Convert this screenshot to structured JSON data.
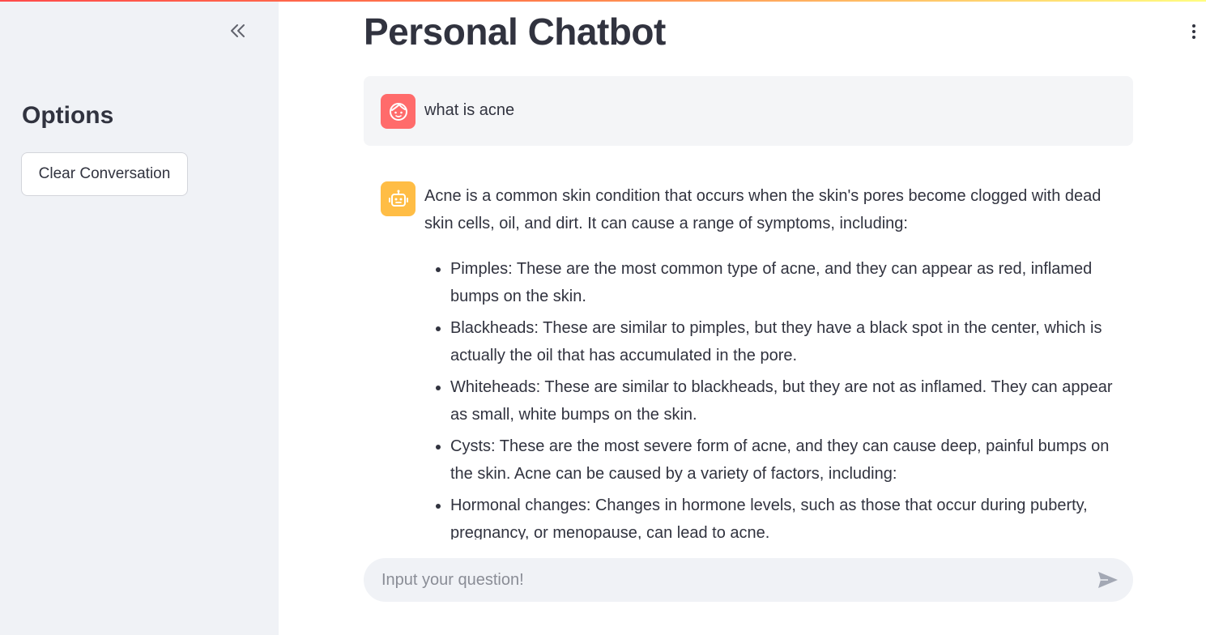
{
  "sidebar": {
    "heading": "Options",
    "clear_button_label": "Clear Conversation"
  },
  "main": {
    "title": "Personal Chatbot"
  },
  "messages": {
    "user": {
      "avatar_icon": "user-face-icon",
      "text": "what is acne"
    },
    "assistant": {
      "avatar_icon": "robot-icon",
      "intro": "Acne is a common skin condition that occurs when the skin's pores become clogged with dead skin cells, oil, and dirt. It can cause a range of symptoms, including:",
      "items": [
        "Pimples: These are the most common type of acne, and they can appear as red, inflamed bumps on the skin.",
        "Blackheads: These are similar to pimples, but they have a black spot in the center, which is actually the oil that has accumulated in the pore.",
        "Whiteheads: These are similar to blackheads, but they are not as inflamed. They can appear as small, white bumps on the skin.",
        "Cysts: These are the most severe form of acne, and they can cause deep, painful bumps on the skin. Acne can be caused by a variety of factors, including:",
        "Hormonal changes: Changes in hormone levels, such as those that occur during puberty, pregnancy, or menopause, can lead to acne."
      ]
    }
  },
  "chat_input": {
    "placeholder": "Input your question!",
    "value": ""
  },
  "icons": {
    "collapse": "double-chevron-left-icon",
    "menu": "vertical-dots-icon",
    "send": "send-arrow-icon"
  },
  "colors": {
    "user_avatar": "#ff6b6b",
    "assistant_avatar": "#ffbd45",
    "sidebar_bg": "#f0f2f6",
    "text": "#31333f"
  }
}
